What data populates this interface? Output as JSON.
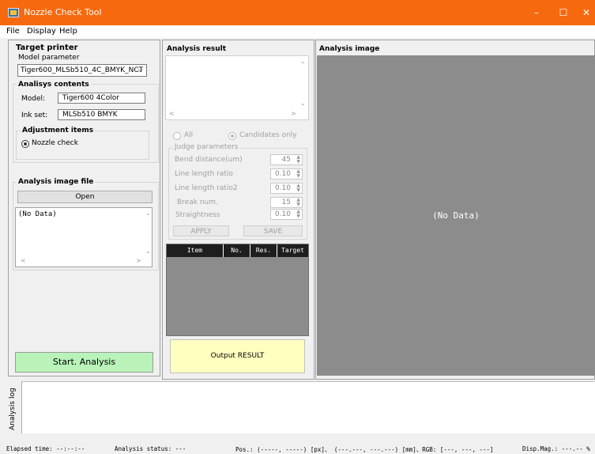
{
  "window": {
    "title": "Nozzle Check Tool",
    "controls": [
      "–",
      "☐",
      "✕"
    ]
  },
  "menu": [
    "File",
    "Display",
    "Help"
  ],
  "left": {
    "target_printer": "Target printer",
    "model_parameter_label": "Model parameter",
    "model_parameter_value": "Tiger600_MLSb510_4C_BMYK_NCT",
    "analysis_contents": "Analisys contents",
    "model_label": "Model:",
    "model_value": "Tiger600 4Color",
    "inkset_label": "Ink set:",
    "inkset_value": "MLSb510 BMYK",
    "adjustment_items": "Adjustment items",
    "nozzle_check": "Nozzle check",
    "image_file_title": "Analysis image file",
    "open_button": "Open",
    "file_list": "(No Data)",
    "start_button": "Start. Analysis"
  },
  "middle": {
    "title": "Analysis result",
    "radio_all": "All",
    "radio_candidates": "Candidates only",
    "judge_parameters": "Judge parameters",
    "params": [
      {
        "label": "Bend distance(um)",
        "value": "45"
      },
      {
        "label": "Line length ratio",
        "value": "0.10"
      },
      {
        "label": "Line length ratio2",
        "value": "0.10"
      },
      {
        "label": "Break num.",
        "value": "15"
      },
      {
        "label": "Straightness",
        "value": "0.10"
      }
    ],
    "apply_button": "APPLY",
    "save_button": "SAVE",
    "grid_columns": [
      "Item",
      "No.",
      "Res.",
      "Target"
    ],
    "output_button": "Output RESULT"
  },
  "right": {
    "title": "Analysis image",
    "placeholder": "(No Data)"
  },
  "log": {
    "tab_label": "Analysis log"
  },
  "status": {
    "elapsed": "Elapsed time: --:--:--",
    "analysis_status": "Analysis status: ---",
    "position": "Pos.: (-----, -----) [px]、 (---.---, ---.---) [mm]、RGB: [---, ---, ---]",
    "disp_mag": "Disp.Mag.: ---.-- %"
  },
  "colors": {
    "titlebar": "#f7690e",
    "start_button": "#b9f3b9",
    "output_button": "#ffffc0",
    "image_area": "#8c8c8c",
    "grid_header": "#1e1e1e",
    "grid_body": "#8c8c8c"
  }
}
